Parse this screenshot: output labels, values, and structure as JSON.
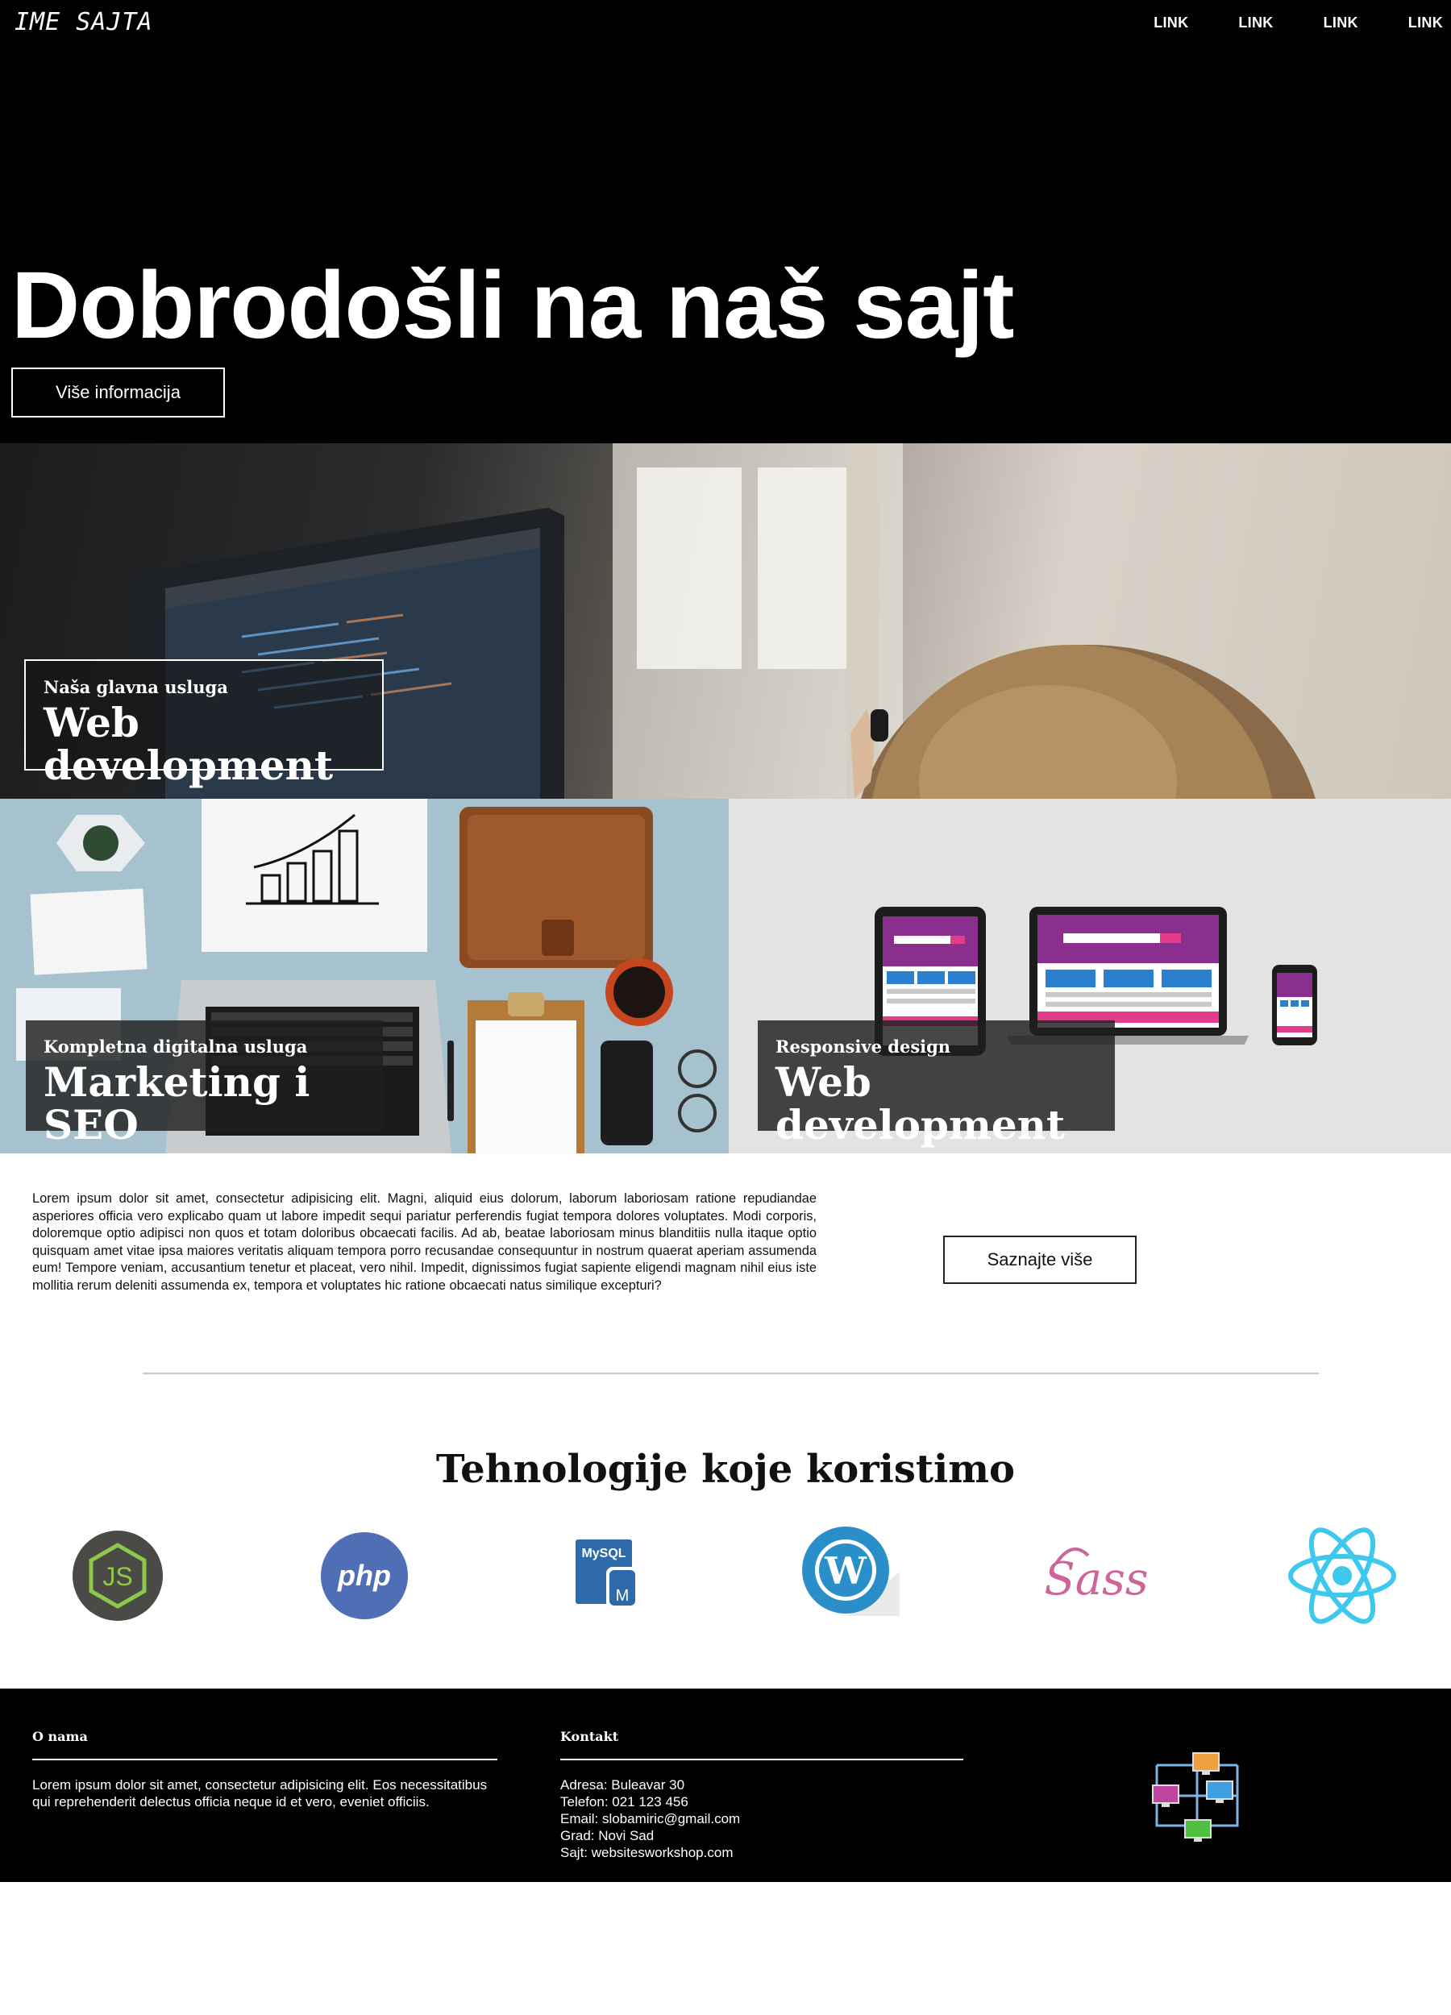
{
  "header": {
    "logo": "IME SAJTA",
    "nav_links": [
      "LINK",
      "LINK",
      "LINK",
      "LINK"
    ]
  },
  "hero": {
    "title": "Dobrodošli na naš sajt",
    "button_label": "Više informacija"
  },
  "services": {
    "main": {
      "subtitle": "Naša glavna usluga",
      "title": "Web development"
    },
    "marketing": {
      "subtitle": "Kompletna digitalna usluga",
      "title": "Marketing i SEO"
    },
    "responsive": {
      "subtitle": "Responsive design",
      "title": "Web development"
    }
  },
  "intro": {
    "text": "Lorem ipsum dolor sit amet, consectetur adipisicing elit. Magni, aliquid eius dolorum, laborum laboriosam ratione repudiandae asperiores officia vero explicabo quam ut labore impedit sequi pariatur perferendis fugiat tempora dolores voluptates. Modi corporis, doloremque optio adipisci non quos et totam doloribus obcaecati facilis. Ad ab, beatae laboriosam minus blanditiis nulla itaque optio quisquam amet vitae ipsa maiores veritatis aliquam tempora porro recusandae consequuntur in nostrum quaerat aperiam assumenda eum! Tempore veniam, accusantium tenetur et placeat, vero nihil. Impedit, dignissimos fugiat sapiente eligendi magnam nihil eius iste mollitia rerum deleniti assumenda ex, tempora et voluptates hic ratione obcaecati natus similique excepturi?",
    "button_label": "Saznajte više"
  },
  "technologies": {
    "title": "Tehnologije koje koristimo",
    "icons": [
      {
        "name": "nodejs-icon",
        "label": "JS",
        "color": "#4a4a46",
        "accent": "#8cc84b"
      },
      {
        "name": "php-icon",
        "label": "php",
        "color": "#4f6eb6"
      },
      {
        "name": "mysql-icon",
        "label": "MySQL",
        "color": "#2e6aa8"
      },
      {
        "name": "wordpress-icon",
        "label": "W",
        "color": "#2a8fc9"
      },
      {
        "name": "sass-icon",
        "label": "Sass",
        "color": "#cc6699"
      },
      {
        "name": "react-icon",
        "label": "",
        "color": "#3fc8ee"
      }
    ]
  },
  "footer": {
    "about": {
      "heading": "O nama",
      "text": "Lorem ipsum dolor sit amet, consectetur adipisicing elit. Eos necessitatibus qui reprehenderit delectus officia neque id et vero, eveniet officiis."
    },
    "contact": {
      "heading": "Kontakt",
      "lines": [
        "Adresa: Buleavar 30",
        "Telefon: 021 123 456",
        "Email: slobamiric@gmail.com",
        "Grad: Novi Sad",
        "Sajt: websitesworkshop.com"
      ]
    }
  }
}
